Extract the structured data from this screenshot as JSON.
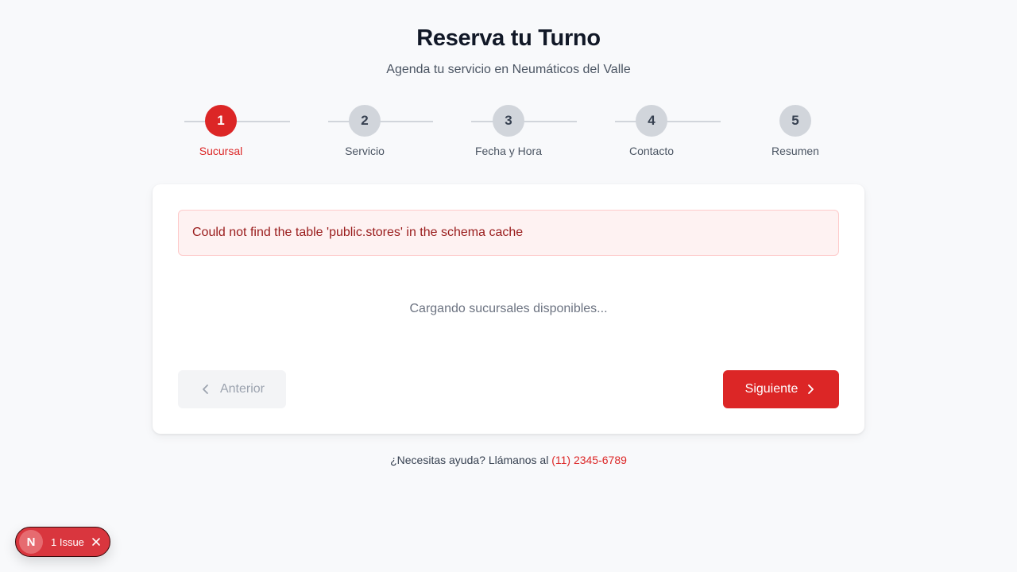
{
  "header": {
    "title": "Reserva tu Turno",
    "subtitle": "Agenda tu servicio en Neumáticos del Valle"
  },
  "steps": [
    {
      "number": "1",
      "label": "Sucursal",
      "active": true
    },
    {
      "number": "2",
      "label": "Servicio",
      "active": false
    },
    {
      "number": "3",
      "label": "Fecha y Hora",
      "active": false
    },
    {
      "number": "4",
      "label": "Contacto",
      "active": false
    },
    {
      "number": "5",
      "label": "Resumen",
      "active": false
    }
  ],
  "card": {
    "error_message": "Could not find the table 'public.stores' in the schema cache",
    "loading_text": "Cargando sucursales disponibles...",
    "prev_label": "Anterior",
    "next_label": "Siguiente"
  },
  "help": {
    "text": "¿Necesitas ayuda? Llámanos al ",
    "phone": "(11) 2345-6789"
  },
  "dev_overlay": {
    "logo_letter": "N",
    "issues_label": "1 Issue"
  },
  "colors": {
    "accent": "#dc2626",
    "inactive_step": "#d1d5db",
    "error_bg": "#fef2f2",
    "error_text": "#991b1b"
  },
  "icons": {
    "prev": "chevron-left-icon",
    "next": "chevron-right-icon",
    "close": "close-icon"
  }
}
